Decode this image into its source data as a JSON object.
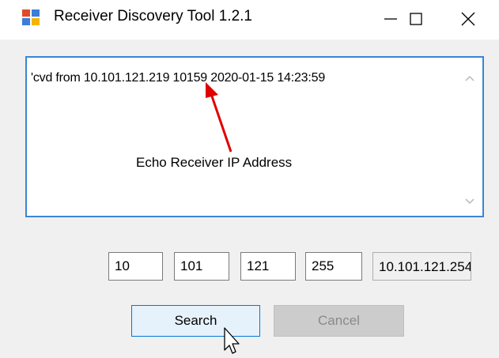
{
  "window": {
    "title": "Receiver Discovery Tool 1.2.1"
  },
  "output": {
    "text": "'cvd from 10.101.121.219  10159 2020-01-15 14:23:59"
  },
  "annotation": {
    "label": "Echo Receiver IP Address",
    "color": "#e00000"
  },
  "ip_fields": {
    "octet1": "10",
    "octet2": "101",
    "octet3": "121",
    "octet4": "255",
    "range_display": "10.101.121.254"
  },
  "buttons": {
    "search": "Search",
    "cancel": "Cancel"
  },
  "icons": {
    "app": "app-icon",
    "minimize": "minimize-icon",
    "maximize": "maximize-icon",
    "close": "close-icon",
    "cursor": "mouse-pointer-icon"
  },
  "colors": {
    "focus_border": "#3a86d4",
    "button_hover_bg": "#e5f1fb",
    "button_hover_border": "#0078d7"
  }
}
